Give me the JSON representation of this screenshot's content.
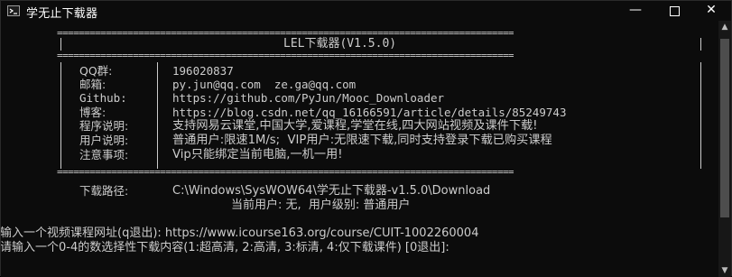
{
  "window": {
    "title": "学无止下载器",
    "buttons": {
      "minimize": "—",
      "maximize": "",
      "close": "✕"
    }
  },
  "banner": {
    "rule": "====================================================================================",
    "title": "LEL下载器(V1.5.0)",
    "info": [
      {
        "key": "QQ群:",
        "value": "196020837"
      },
      {
        "key": "邮箱:",
        "value": "py.jun@qq.com  ze.ga@qq.com"
      },
      {
        "key": "Github:",
        "value": "https://github.com/PyJun/Mooc_Downloader"
      },
      {
        "key": "博客:",
        "value": "https://blog.csdn.net/qq_16166591/article/details/85249743"
      },
      {
        "key": "程序说明:",
        "value": "支持网易云课堂,中国大学,爱课程,学堂在线,四大网站视频及课件下载!"
      },
      {
        "key": "用户说明:",
        "value": "普通用户:限速1M/s;  VIP用户:无限速下载,同时支持登录下载已购买课程"
      },
      {
        "key": "注意事项:",
        "value": "Vip只能绑定当前电脑,一机一用!"
      }
    ]
  },
  "download": {
    "path_label": "下载路径:",
    "path_value": "C:\\Windows\\SysWOW64\\学无止下载器-v1.5.0\\Download",
    "user_line": "当前用户: 无,  用户级别: 普通用户"
  },
  "prompts": {
    "url_prompt": "输入一个视频课程网址(q退出): https://www.icourse163.org/course/CUIT-1002260004",
    "choice_prompt": "请输入一个0-4的数选择性下载内容(1:超高清, 2:高清, 3:标清, 4:仅下载课件) [0退出]:"
  }
}
